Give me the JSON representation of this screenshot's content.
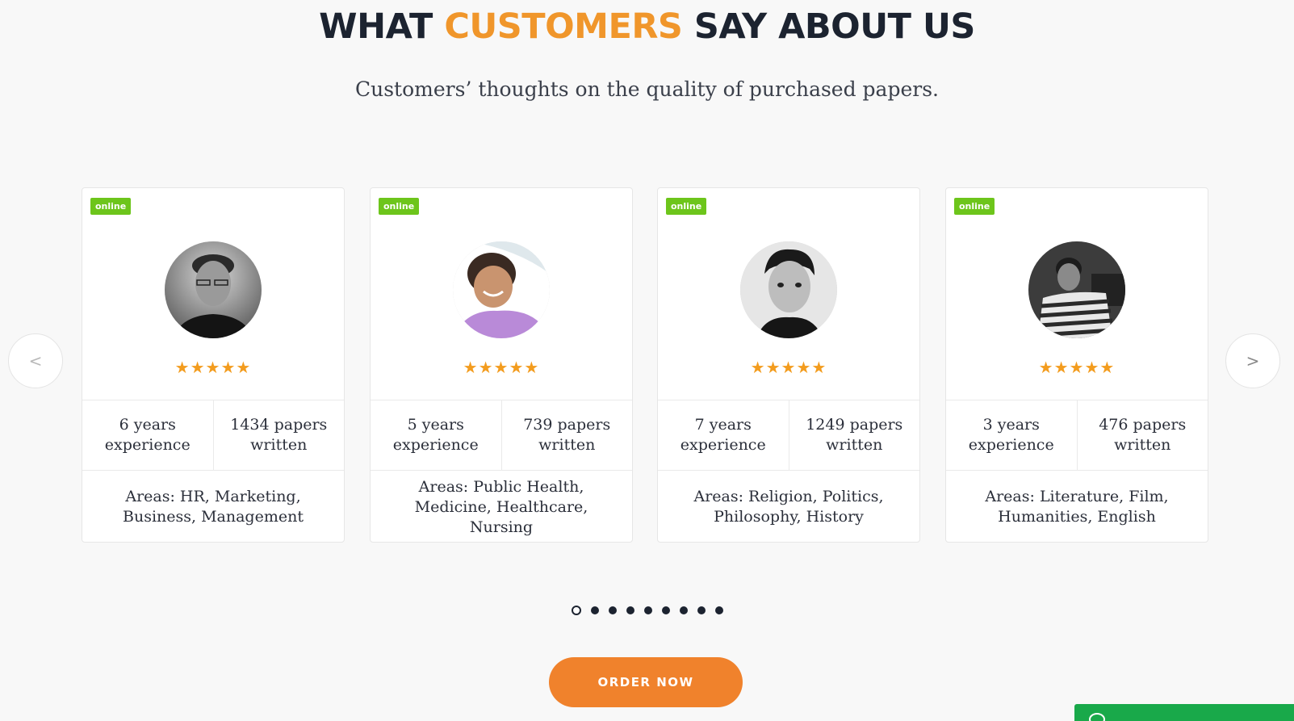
{
  "heading": {
    "part1": "WHAT ",
    "accent": "CUSTOMERS",
    "part2": " SAY ABOUT US"
  },
  "subheading": "Customers’ thoughts on the quality of purchased papers.",
  "carousel": {
    "prev_label": "<",
    "next_label": ">",
    "cards": [
      {
        "badge": "online",
        "stars": "★★★★★",
        "rating": 5,
        "experience": "6 years experience",
        "papers": "1434 papers written",
        "areas": "Areas: HR, Marketing, Business, Management"
      },
      {
        "badge": "online",
        "stars": "★★★★★",
        "rating": 5,
        "experience": "5 years experience",
        "papers": "739 papers written",
        "areas": "Areas: Public Health, Medicine, Healthcare, Nursing"
      },
      {
        "badge": "online",
        "stars": "★★★★★",
        "rating": 5,
        "experience": "7 years experience",
        "papers": "1249 papers written",
        "areas": "Areas: Religion, Politics, Philosophy, History"
      },
      {
        "badge": "online",
        "stars": "★★★★★",
        "rating": 5,
        "experience": "3 years experience",
        "papers": "476 papers written",
        "areas": "Areas: Literature, Film, Humanities, English"
      }
    ],
    "pagination": {
      "total": 9,
      "active": 1
    }
  },
  "order_button": "ORDER NOW",
  "colors": {
    "accent": "#f0962b",
    "badge": "#6dc51b",
    "stars": "#f39c1e",
    "button": "#f0822c",
    "chat": "#19a94a"
  },
  "icons": {
    "prev": "chevron-left-icon",
    "next": "chevron-right-icon",
    "chat": "chat-bubble-icon",
    "star": "star-icon"
  }
}
